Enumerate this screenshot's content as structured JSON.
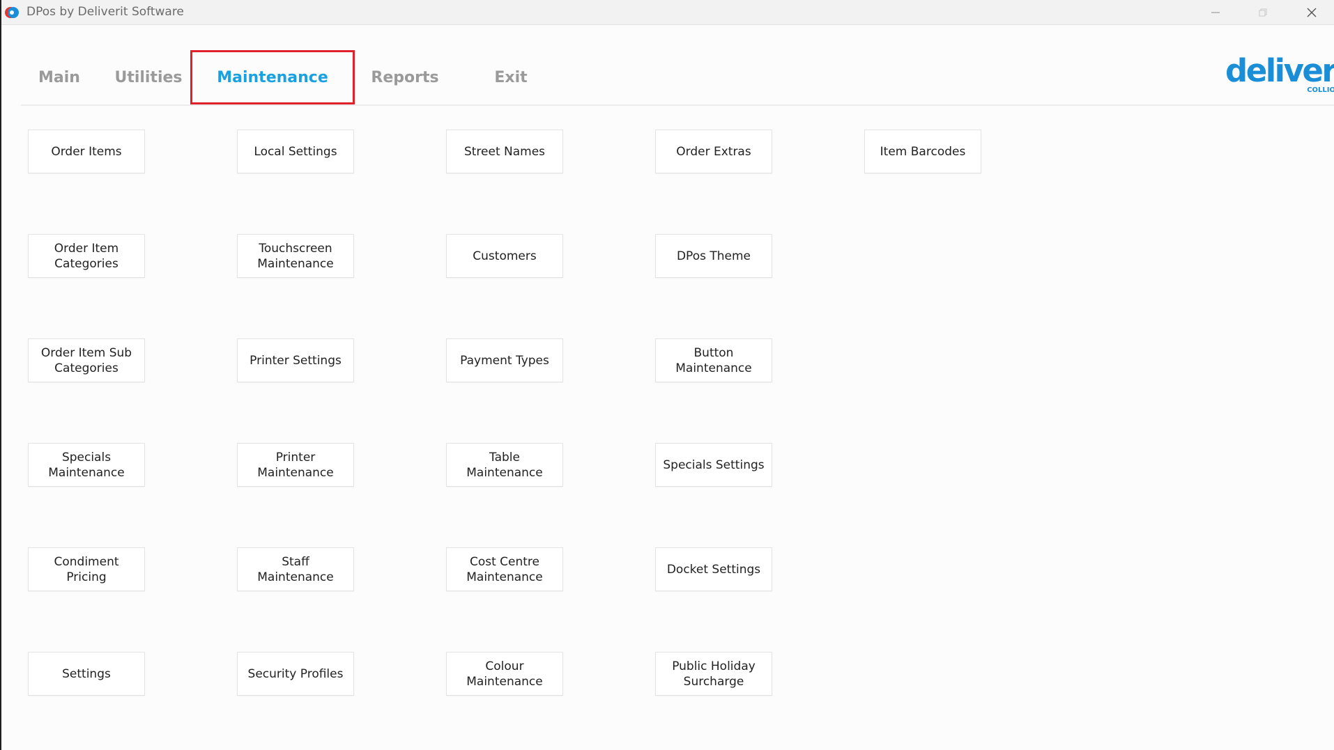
{
  "window": {
    "title": "DPos by Deliverit Software"
  },
  "tabs": [
    {
      "label": "Main",
      "active": false
    },
    {
      "label": "Utilities",
      "active": false
    },
    {
      "label": "Maintenance",
      "active": true
    },
    {
      "label": "Reports",
      "active": false
    },
    {
      "label": "Exit",
      "active": false
    }
  ],
  "logo": {
    "word": "deliverit",
    "sub": "COLLIO"
  },
  "colors": {
    "accent": "#1aa1e1",
    "tab_inactive": "#9a9a9a",
    "highlight_box": "#e0202a",
    "logo": "#1a8fd8"
  },
  "buttons": {
    "c0": [
      "Order Items",
      "Order Item Categories",
      "Order Item Sub Categories",
      "Specials Maintenance",
      "Condiment Pricing",
      "Settings"
    ],
    "c1": [
      "Local Settings",
      "Touchscreen Maintenance",
      "Printer Settings",
      "Printer Maintenance",
      "Staff Maintenance",
      "Security Profiles"
    ],
    "c2": [
      "Street Names",
      "Customers",
      "Payment Types",
      "Table Maintenance",
      "Cost Centre Maintenance",
      "Colour Maintenance"
    ],
    "c3": [
      "Order Extras",
      "DPos Theme",
      "Button Maintenance",
      "Specials Settings",
      "Docket Settings",
      "Public Holiday Surcharge"
    ],
    "c4": [
      "Item Barcodes"
    ]
  }
}
